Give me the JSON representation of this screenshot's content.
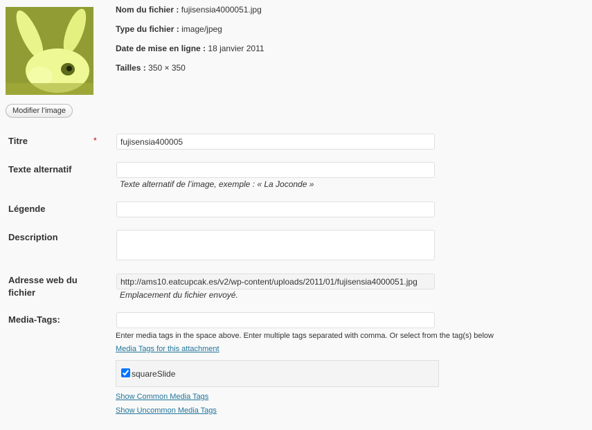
{
  "file_info": {
    "name_label": "Nom du fichier :",
    "name_value": "fujisensia4000051.jpg",
    "type_label": "Type du fichier :",
    "type_value": "image/jpeg",
    "date_label": "Date de mise en ligne :",
    "date_value": "18 janvier 2011",
    "size_label": "Tailles :",
    "size_value": "350 × 350"
  },
  "edit_image_button": "Modifier l’image",
  "fields": {
    "title_label": "Titre",
    "required_mark": "*",
    "title_value": "fujisensia400005",
    "alt_label": "Texte alternatif",
    "alt_value": "",
    "alt_help": "Texte alternatif de l’image, exemple : « La Joconde »",
    "caption_label": "Légende",
    "caption_value": "",
    "description_label": "Description",
    "description_value": "",
    "url_label": "Adresse web du fichier",
    "url_value": "http://ams10.eatcupcak.es/v2/wp-content/uploads/2011/01/fujisensia4000051.jpg",
    "url_help": "Emplacement du fichier envoyé.",
    "media_tags_label": "Media-Tags:",
    "media_tags_value": ""
  },
  "media_tags": {
    "instructions": "Enter media tags in the space above. Enter multiple tags separated with comma. Or select from the tag(s) below",
    "attachment_link": "Media Tags for this attachment",
    "tags": [
      {
        "name": "squareSlide",
        "checked": true
      }
    ],
    "common_link": "Show Common Media Tags",
    "uncommon_link": "Show Uncommon Media Tags"
  },
  "colors": {
    "link": "#21759b",
    "required": "#cc0000",
    "background": "#f9f9f9"
  }
}
